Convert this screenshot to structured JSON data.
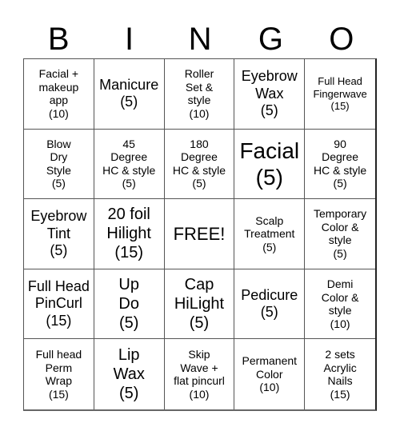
{
  "header": {
    "letters": [
      "B",
      "I",
      "N",
      "G",
      "O"
    ]
  },
  "cells": [
    "Facial +\nmakeup\napp\n(10)",
    "Manicure\n(5)",
    "Roller\nSet &\nstyle\n(10)",
    "Eyebrow\nWax\n(5)",
    "Full Head\nFingerwave\n(15)",
    "Blow\nDry\nStyle\n(5)",
    "45\nDegree\nHC & style\n(5)",
    "180\nDegree\nHC & style\n(5)",
    "Facial\n(5)",
    "90\nDegree\nHC & style\n(5)",
    "Eyebrow\nTint\n(5)",
    "20 foil\nHilight\n(15)",
    "FREE!",
    "Scalp\nTreatment\n(5)",
    "Temporary\nColor &\nstyle\n(5)",
    "Full Head\nPinCurl\n(15)",
    "Up\nDo\n(5)",
    "Cap\nHiLight\n(5)",
    "Pedicure\n(5)",
    "Demi\nColor &\nstyle\n(10)",
    "Full head\nPerm\nWrap\n(15)",
    "Lip\nWax\n(5)",
    "Skip\nWave +\nflat pincurl\n(10)",
    "Permanent\nColor\n(10)",
    "2 sets\nAcrylic\nNails\n(15)"
  ]
}
